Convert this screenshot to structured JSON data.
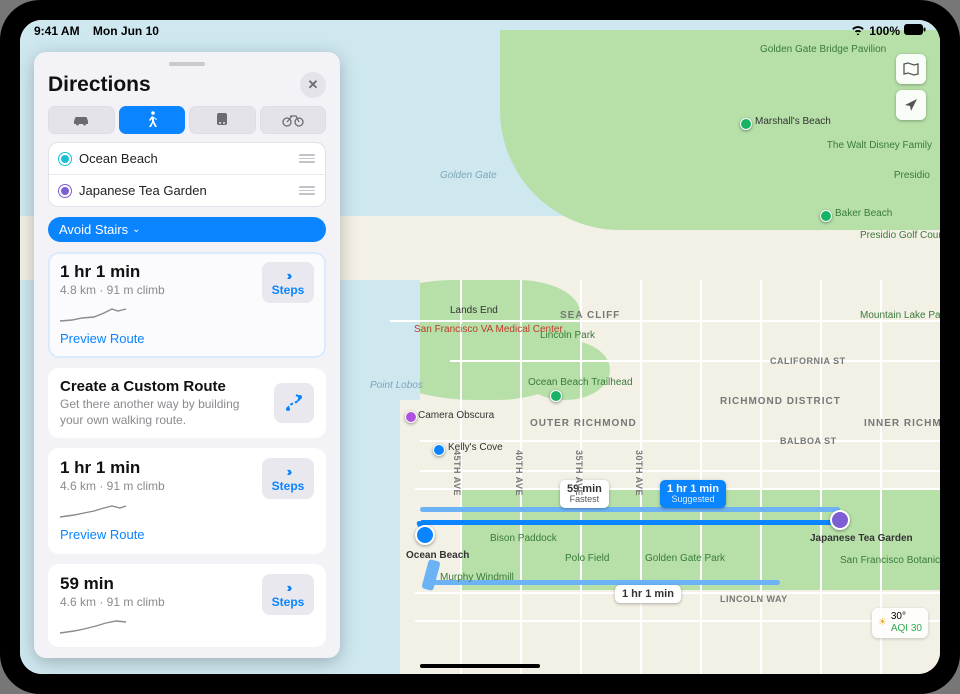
{
  "status": {
    "time": "9:41 AM",
    "date": "Mon Jun 10",
    "batt": "100%"
  },
  "panel": {
    "title": "Directions",
    "modes": {
      "car": "car",
      "walk": "walk",
      "transit": "transit",
      "bike": "bike"
    },
    "stops": {
      "from": "Ocean Beach",
      "to": "Japanese Tea Garden"
    },
    "option": "Avoid Stairs",
    "custom": {
      "title": "Create a Custom Route",
      "sub": "Get there another way by building your own walking route."
    },
    "routes": [
      {
        "time": "1 hr 1 min",
        "sub": "4.8 km · 91 m climb",
        "preview": "Preview Route",
        "cta": "Steps"
      },
      {
        "time": "1 hr 1 min",
        "sub": "4.6 km · 91 m climb",
        "preview": "Preview Route",
        "cta": "Steps"
      },
      {
        "time": "59 min",
        "sub": "4.6 km · 91 m climb",
        "preview": "Preview Route",
        "cta": "Steps"
      }
    ]
  },
  "map": {
    "badges": {
      "suggested": {
        "t": "1 hr 1 min",
        "s": "Suggested"
      },
      "fastest": {
        "t": "59 min",
        "s": "Fastest"
      },
      "alt": {
        "t": "1 hr 1 min",
        "s": ""
      }
    },
    "pins": {
      "origin": "Ocean Beach",
      "dest": "Japanese Tea Garden"
    },
    "labels": {
      "gg": "Golden Gate",
      "bridgepav": "Golden Gate Bridge Pavilion",
      "marshalls": "Marshall's Beach",
      "baker": "Baker Beach",
      "landsend": "Lands End",
      "ptlobos": "Point Lobos",
      "cameraobs": "Camera Obscura",
      "kellys": "Kelly's Cove",
      "sfva": "San Francisco VA Medical Center",
      "lincolnpark": "Lincoln Park",
      "obtrail": "Ocean Beach Trailhead",
      "seacliff": "SEA CLIFF",
      "outerrich": "OUTER RICHMOND",
      "richmond": "RICHMOND DISTRICT",
      "innerrich": "INNER RICHMOND",
      "california": "CALIFORNIA ST",
      "balboa": "BALBOA ST",
      "lincoln": "LINCOLN WAY",
      "a45": "45TH AVE",
      "a40": "40TH AVE",
      "a35": "35TH AVE",
      "a30": "30TH AVE",
      "bison": "Bison Paddock",
      "polo": "Polo Field",
      "ggpark": "Golden Gate Park",
      "murphy": "Murphy Windmill",
      "mountainlk": "Mountain Lake Park",
      "presgolf": "Presidio Golf Course",
      "presidio": "Presidio",
      "waltdisney": "The Walt Disney Family",
      "sfbot": "San Francisco Botanical"
    },
    "weather": {
      "temp": "30°",
      "aqi": "AQI 30"
    }
  }
}
